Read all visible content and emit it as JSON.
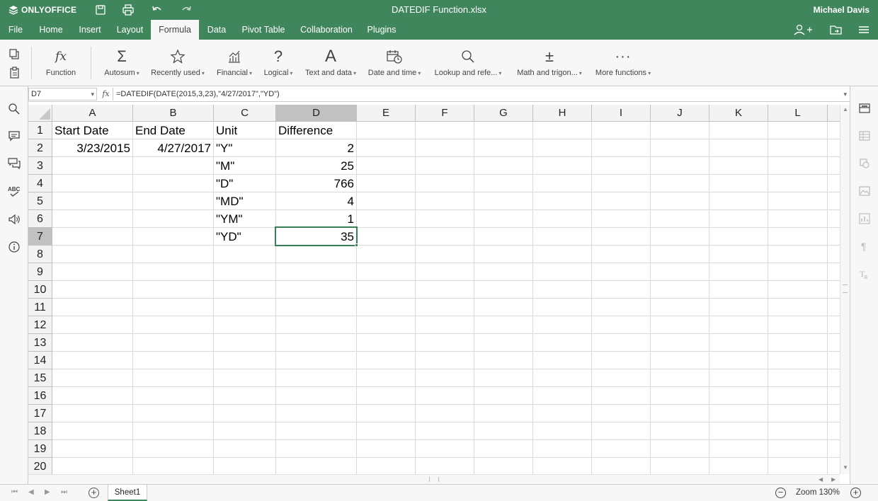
{
  "app": {
    "logo_text": "ONLYOFFICE",
    "doc_title": "DATEDIF Function.xlsx",
    "user": "Michael Davis"
  },
  "menu": {
    "tabs": [
      "File",
      "Home",
      "Insert",
      "Layout",
      "Formula",
      "Data",
      "Pivot Table",
      "Collaboration",
      "Plugins"
    ],
    "active": "Formula"
  },
  "ribbon": {
    "function": "Function",
    "autosum": "Autosum",
    "recently_used": "Recently used",
    "financial": "Financial",
    "logical": "Logical",
    "text_and_data": "Text and data",
    "date_and_time": "Date and time",
    "lookup": "Lookup and refe...",
    "math": "Math and trigon...",
    "more": "More functions"
  },
  "formula_bar": {
    "cell_ref": "D7",
    "fx": "fx",
    "formula": "=DATEDIF(DATE(2015,3,23),\"4/27/2017\",\"YD\")"
  },
  "sheet": {
    "columns": [
      "A",
      "B",
      "C",
      "D",
      "E",
      "F",
      "G",
      "H",
      "I",
      "J",
      "K",
      "L"
    ],
    "rows": [
      "1",
      "2",
      "3",
      "4",
      "5",
      "6",
      "7",
      "8",
      "9",
      "10",
      "11",
      "12",
      "13",
      "14",
      "15",
      "16",
      "17",
      "18",
      "19",
      "20"
    ],
    "selected_cell": "D7",
    "cells": {
      "A1": "Start Date",
      "B1": "End Date",
      "C1": "Unit",
      "D1": "Difference",
      "A2": "3/23/2015",
      "B2": "4/27/2017",
      "C2": "\"Y\"",
      "D2": "2",
      "C3": "\"M\"",
      "D3": "25",
      "C4": "\"D\"",
      "D4": "766",
      "C5": "\"MD\"",
      "D5": "4",
      "C6": "\"YM\"",
      "D6": "1",
      "C7": "\"YD\"",
      "D7": "35"
    }
  },
  "status": {
    "sheet_tab": "Sheet1",
    "zoom": "Zoom 130%"
  },
  "colors": {
    "brand": "#40865c",
    "selection": "#3b7f56"
  }
}
